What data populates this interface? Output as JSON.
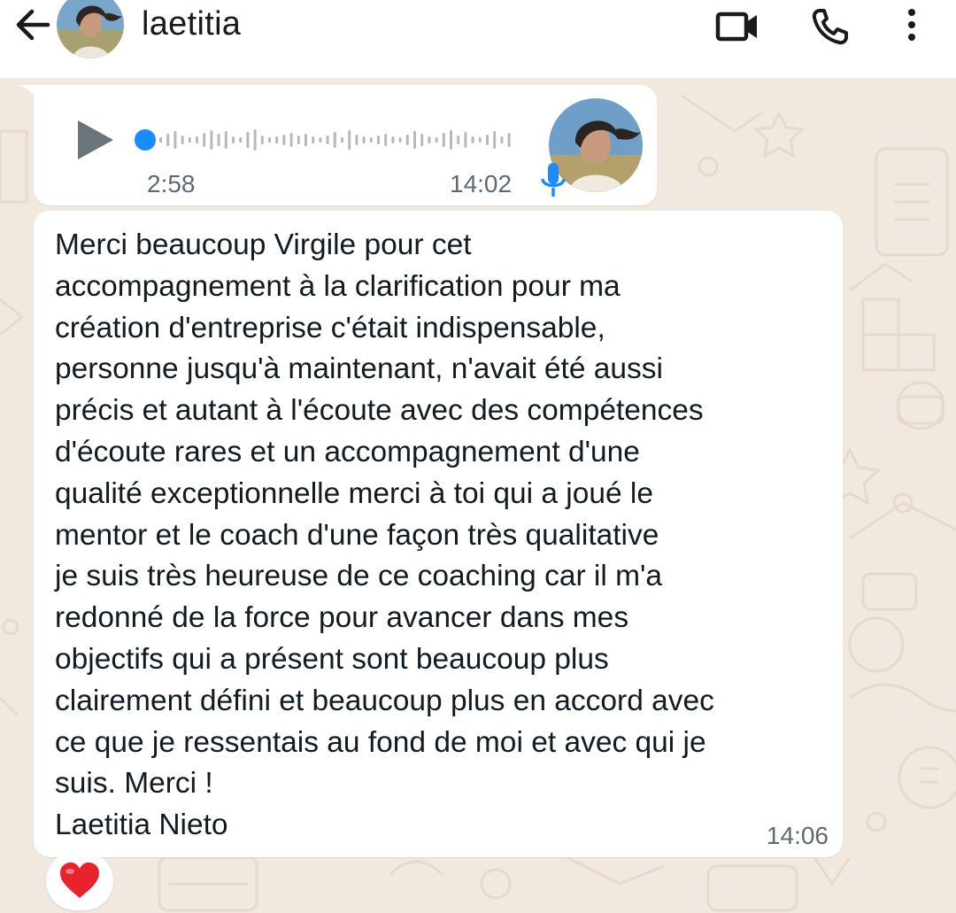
{
  "header": {
    "contact_name": "laetitia",
    "icons": [
      "back-arrow-icon",
      "video-call-icon",
      "phone-icon",
      "more-vertical-icon"
    ]
  },
  "voice_message": {
    "duration": "2:58",
    "time": "14:02",
    "progress": 0,
    "icons": [
      "play-icon",
      "microphone-icon"
    ],
    "accent_color": "#1a8cff"
  },
  "text_message": {
    "body": "Merci beaucoup Virgile pour cet\naccompagnement à la clarification pour ma\ncréation d'entreprise c'était indispensable,\npersonne jusqu'à maintenant, n'avait été  aussi\nprécis et autant à l'écoute avec des compétences\nd'écoute rares et un accompagnement d'une\nqualité exceptionnelle merci à toi qui a joué le\nmentor et le coach d'une façon très qualitative\nje suis très heureuse de ce coaching car il m'a\nredonné de la force pour avancer dans mes\nobjectifs qui a présent sont beaucoup plus\nclairement défini et beaucoup plus en accord avec\nce que je ressentais au fond de moi et avec qui je\nsuis. Merci !\nLaetitia Nieto",
    "time": "14:06"
  },
  "reaction": {
    "emoji": "❤️",
    "icon": "heart-icon",
    "color": "#e8232c"
  }
}
